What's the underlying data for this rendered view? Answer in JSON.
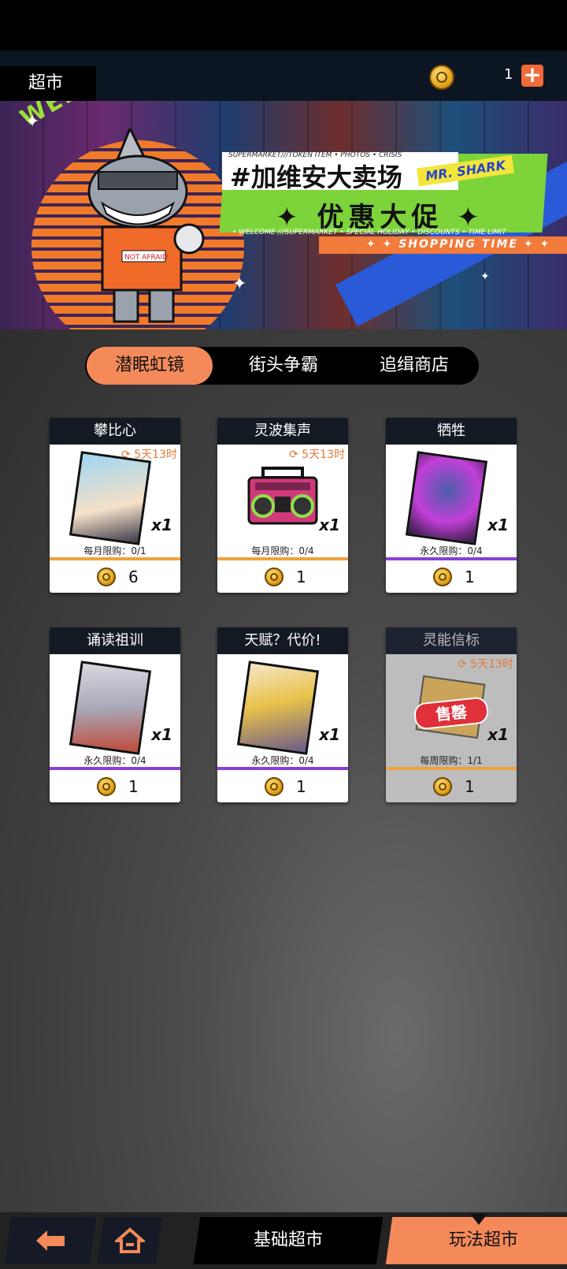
{
  "header": {
    "title": "超市",
    "coin_count": "1",
    "add_label": "+"
  },
  "banner": {
    "arc_text": "WELCOME TO GAVIAN CITY",
    "title": "#加维安大卖场",
    "tag": "MR. SHARK",
    "subtitle": "✦ 优惠大促 ✦",
    "small_top": "SUPERMARKET///TOKEN ITEM • PHOTOS • CRISIS",
    "small_bottom": "• WELCOME ///SUPERMARKET • SPECIAL HOLIDAY • DISCOUNTS • TIME LIMIT",
    "strip_text": "✦ ✦ SHOPPING TIME ✦ ✦",
    "shark_shirt": "NOT AFRAID"
  },
  "tabs": [
    {
      "label": "潜眠虹镜",
      "active": true
    },
    {
      "label": "街头争霸",
      "active": false
    },
    {
      "label": "追缉商店",
      "active": false
    }
  ],
  "items": [
    {
      "name": "攀比心",
      "refresh": "5天13时",
      "qty": "x1",
      "limit": "每月限购：0/1",
      "price": "6",
      "bar_color": "#f0a23a",
      "disabled": false
    },
    {
      "name": "灵波集声",
      "refresh": "5天13时",
      "qty": "x1",
      "limit": "每月限购：0/4",
      "price": "1",
      "bar_color": "#f0a23a",
      "disabled": false
    },
    {
      "name": "牺牲",
      "refresh": "",
      "qty": "x1",
      "limit": "永久限购：0/4",
      "price": "1",
      "bar_color": "#8a3fd6",
      "disabled": false
    },
    {
      "name": "诵读祖训",
      "refresh": "",
      "qty": "x1",
      "limit": "永久限购：0/4",
      "price": "1",
      "bar_color": "#8a3fd6",
      "disabled": false
    },
    {
      "name": "天赋？代价!",
      "refresh": "",
      "qty": "x1",
      "limit": "永久限购：0/4",
      "price": "1",
      "bar_color": "#8a3fd6",
      "disabled": false
    },
    {
      "name": "灵能信标",
      "refresh": "5天13时",
      "qty": "x1",
      "limit": "每周限购：1/1",
      "price": "1",
      "bar_color": "#f0a23a",
      "disabled": true,
      "stamp": "售罄"
    }
  ],
  "bottom_nav": {
    "back_icon": "back-arrow-icon",
    "home_icon": "home-icon",
    "basic_label": "基础超市",
    "play_label": "玩法超市"
  }
}
